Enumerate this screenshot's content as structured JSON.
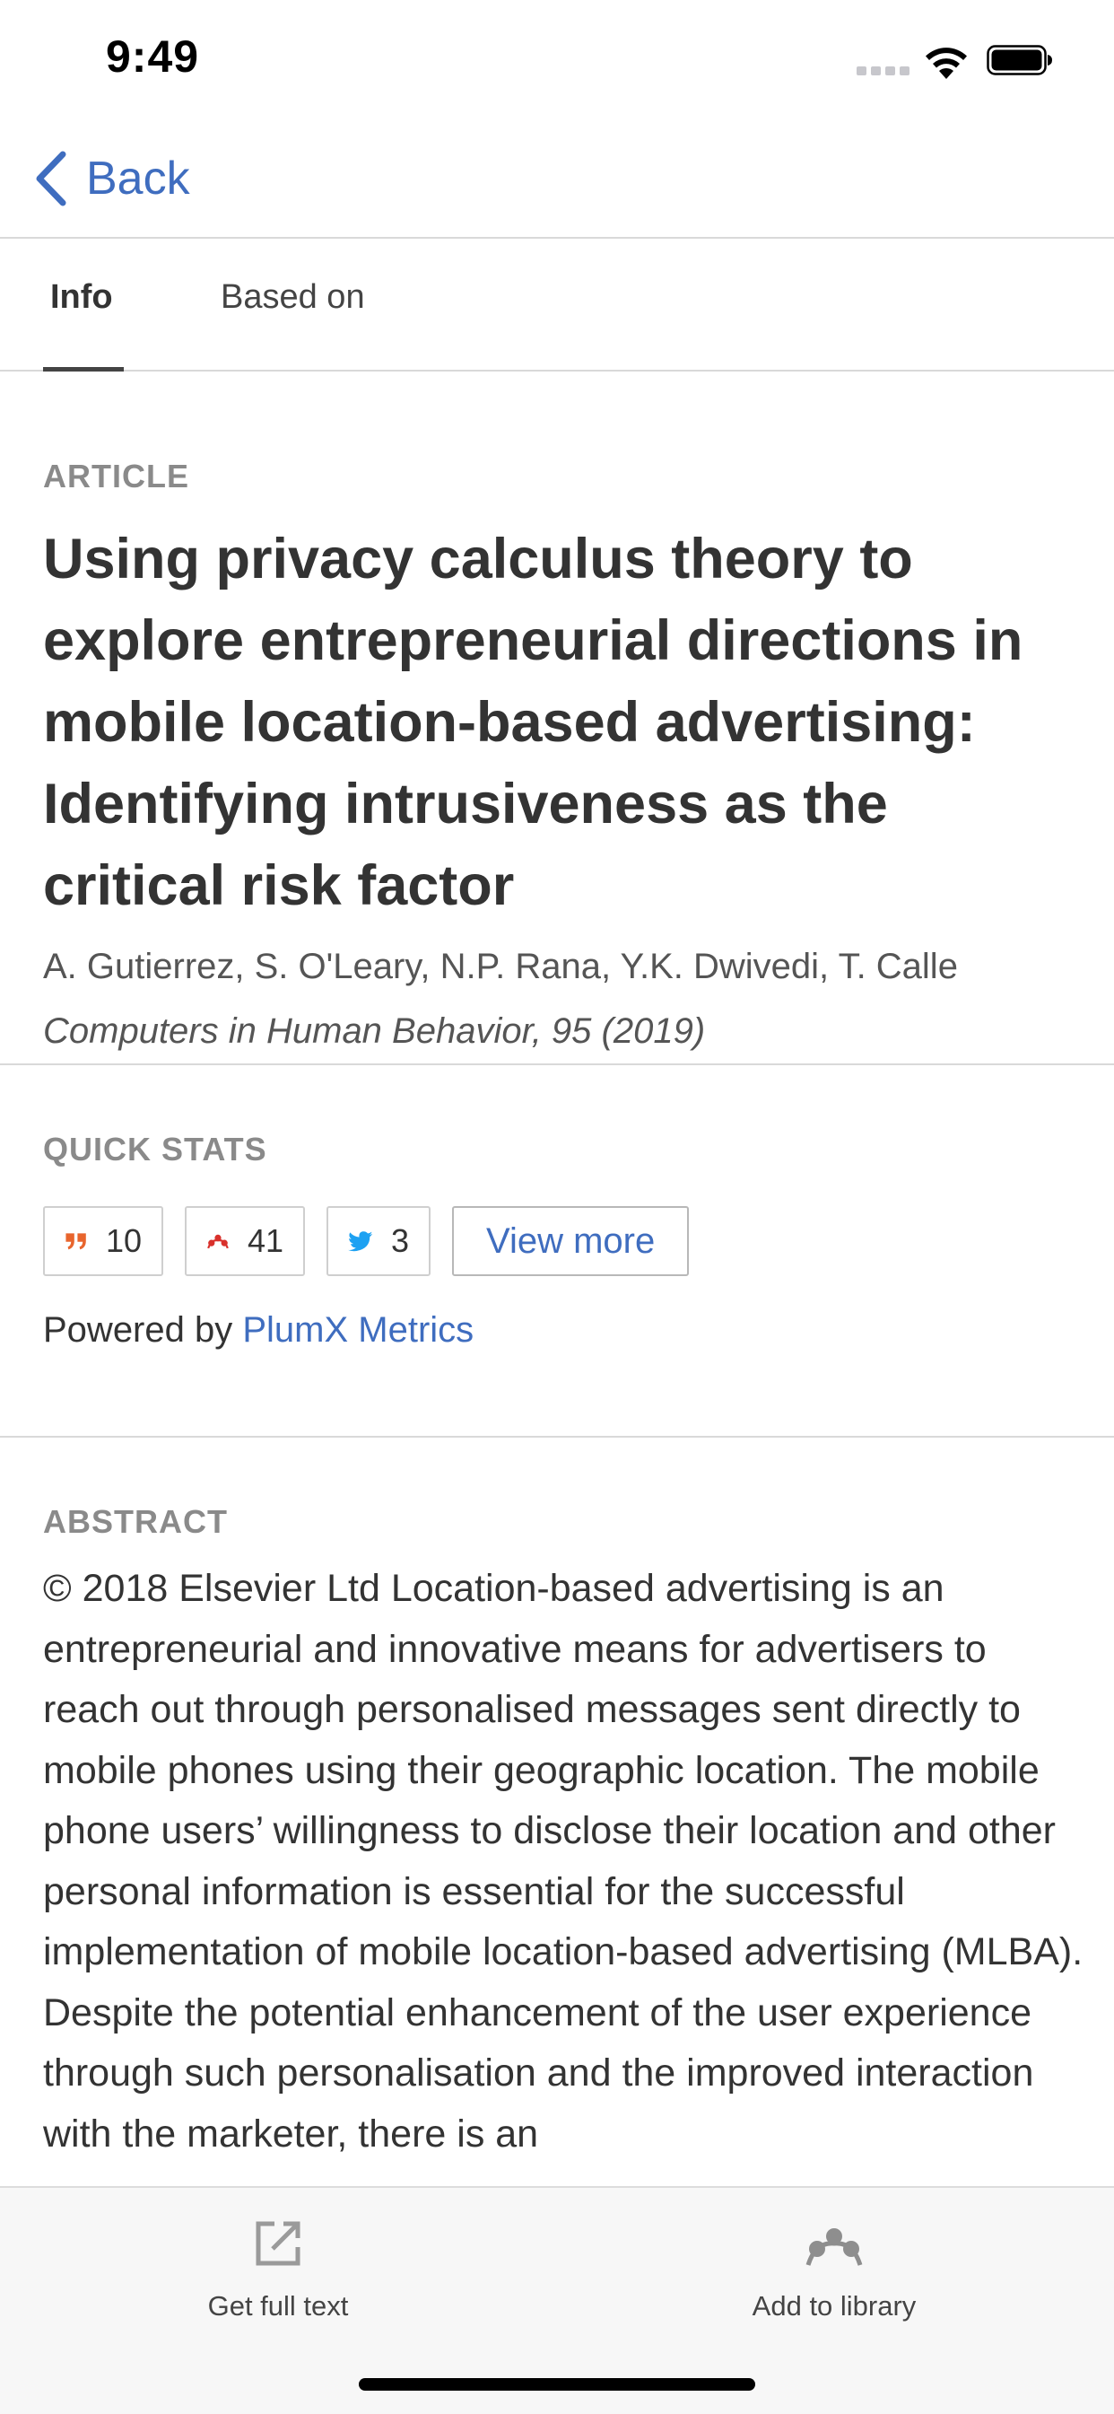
{
  "status_bar": {
    "time": "9:49"
  },
  "nav": {
    "back_label": "Back"
  },
  "tabs": [
    {
      "label": "Info",
      "selected": true
    },
    {
      "label": "Based on",
      "selected": false
    }
  ],
  "article": {
    "type_label": "ARTICLE",
    "title": "Using privacy calculus theory to explore entrepreneurial directions in mobile location-based advertising: Identifying intrusiveness as the critical risk factor",
    "authors": "A. Gutierrez, S. O'Leary, N.P. Rana, Y.K. Dwivedi, T. Calle",
    "journal": "Computers in Human Behavior, 95 (2019)"
  },
  "quick_stats": {
    "label": "QUICK STATS",
    "citations": "10",
    "readers": "41",
    "tweets": "3",
    "view_more_label": "View more",
    "powered_by_prefix": "Powered by",
    "powered_by_link": "PlumX Metrics",
    "colors": {
      "citations": "#e8652d",
      "readers": "#d9312c",
      "tweets": "#1da1f2"
    }
  },
  "abstract": {
    "label": "ABSTRACT",
    "text": "© 2018 Elsevier Ltd Location-based advertising is an entrepreneurial and innovative means for advertisers to reach out through personalised messages sent directly to mobile phones using their geographic location. The mobile phone users’ willingness to disclose their location and other personal information is essential for the successful implementation of mobile location-based advertising (MLBA). Despite the potential enhancement of the user experience through such personalisation and the improved interaction with the marketer, there is an"
  },
  "toolbar": {
    "full_text_label": "Get full text",
    "library_label": "Add to library"
  },
  "colors": {
    "accent": "#3f6dbf",
    "divider": "#d9d9d9"
  }
}
